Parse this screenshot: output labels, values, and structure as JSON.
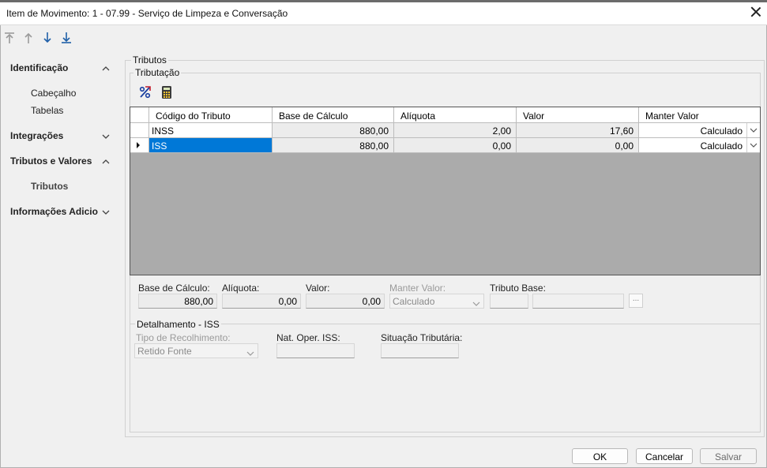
{
  "window": {
    "title": "Item de Movimento: 1 - 07.99 - Serviço de Limpeza e Conversação"
  },
  "toolbar": {
    "icons": [
      "first-record-icon",
      "previous-record-icon",
      "next-record-icon",
      "last-record-icon"
    ]
  },
  "sidebar": {
    "sections": [
      {
        "label": "Identificação",
        "expanded": true,
        "items": [
          "Cabeçalho",
          "Tabelas"
        ]
      },
      {
        "label": "Integrações",
        "expanded": false,
        "items": []
      },
      {
        "label": "Tributos e Valores",
        "expanded": true,
        "items": [
          "Tributos"
        ]
      },
      {
        "label": "Informações Adicio",
        "expanded": false,
        "items": []
      }
    ],
    "active_item": "Tributos"
  },
  "main": {
    "group_title": "Tributos",
    "subgroup_title": "Tributação",
    "grid": {
      "columns": [
        "Código do Tributo",
        "Base de Cálculo",
        "Alíquota",
        "Valor",
        "Manter Valor"
      ],
      "rows": [
        {
          "codigo": "INSS",
          "base": "880,00",
          "aliquota": "2,00",
          "valor": "17,60",
          "manter": "Calculado"
        },
        {
          "codigo": "ISS",
          "base": "880,00",
          "aliquota": "0,00",
          "valor": "0,00",
          "manter": "Calculado"
        }
      ],
      "selected_row": 1
    },
    "detail": {
      "base_label": "Base de Cálculo:",
      "base_value": "880,00",
      "aliquota_label": "Alíquota:",
      "aliquota_value": "0,00",
      "valor_label": "Valor:",
      "valor_value": "0,00",
      "manter_label": "Manter Valor:",
      "manter_value": "Calculado",
      "tributo_base_label": "Tributo Base:",
      "tributo_base_value": "",
      "tributo_base_desc": "",
      "lookup_label": "..."
    },
    "iss": {
      "title": "Detalhamento - ISS",
      "tipo_label": "Tipo de Recolhimento:",
      "tipo_value": "Retido Fonte",
      "nat_label": "Nat. Oper. ISS:",
      "nat_value": "",
      "situacao_label": "Situação Tributária:",
      "situacao_value": ""
    }
  },
  "footer": {
    "ok": "OK",
    "cancel": "Cancelar",
    "save": "Salvar"
  }
}
